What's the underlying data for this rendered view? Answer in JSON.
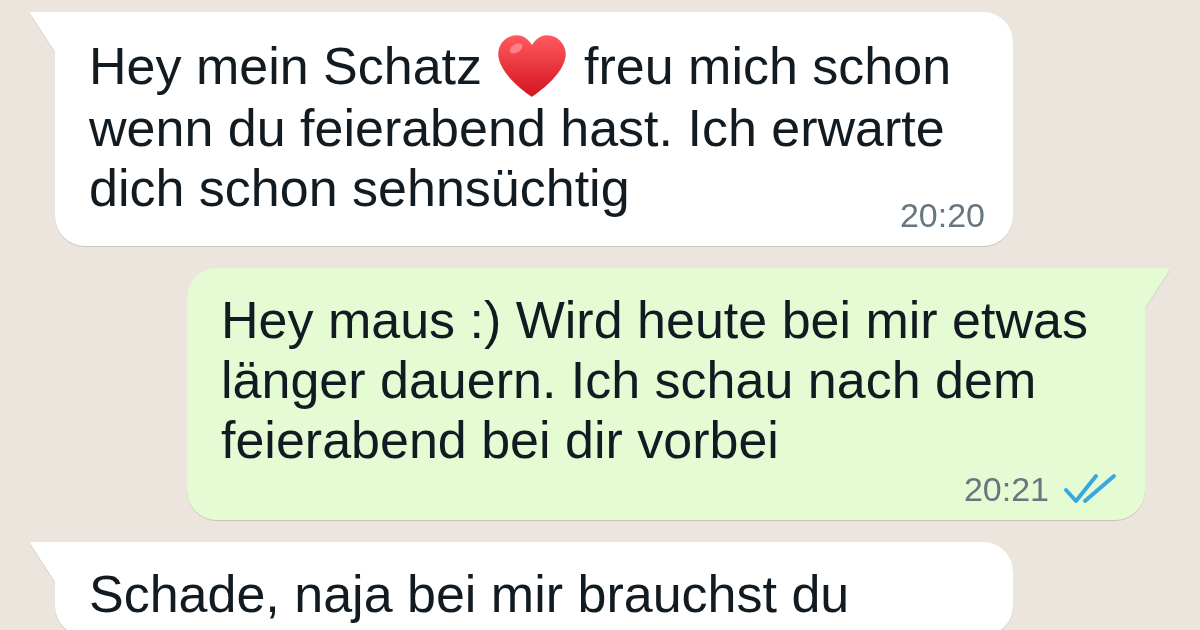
{
  "chat": {
    "messages": [
      {
        "outgoing": false,
        "lines": [
          {
            "segments": [
              {
                "kind": "text",
                "text": "Hey mein Schatz"
              },
              {
                "kind": "emoji"
              },
              {
                "kind": "text",
                "text": "freu mich schon"
              }
            ]
          },
          {
            "segments": [
              {
                "kind": "text",
                "text": "wenn du feierabend hast. Ich erwarte"
              }
            ]
          },
          {
            "segments": [
              {
                "kind": "text",
                "text": "dich schon sehnsüchtig"
              }
            ]
          }
        ],
        "time": "20:20"
      },
      {
        "outgoing": true,
        "text": "Hey maus :) Wird heute bei mir etwas länger dauern. Ich schau nach dem feierabend bei dir vorbei",
        "time": "20:21",
        "read": true
      },
      {
        "outgoing": false,
        "text": "Schade, naja bei mir brauchst du"
      }
    ]
  }
}
